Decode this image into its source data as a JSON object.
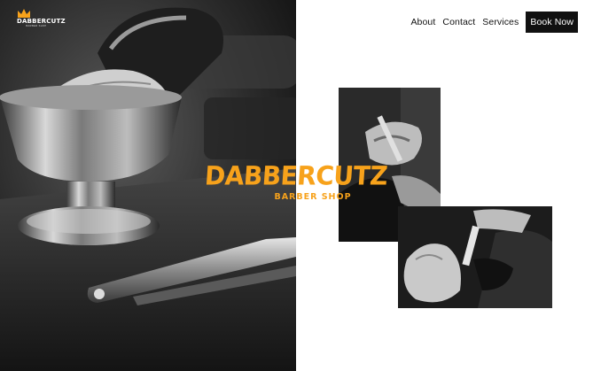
{
  "header": {
    "logo_name": "DABBERCUTZ",
    "logo_tagline": "BARBER SHOP"
  },
  "nav": {
    "about": "About",
    "contact": "Contact",
    "services": "Services",
    "book_now": "Book Now"
  },
  "hero": {
    "brand_name": "DABBERCUTZ",
    "brand_subtitle": "BARBER SHOP"
  },
  "colors": {
    "accent": "#f7a21b",
    "nav_button_bg": "#111111",
    "panel_bg": "#ffffff"
  },
  "icons": {
    "logo": "crown-icon"
  }
}
